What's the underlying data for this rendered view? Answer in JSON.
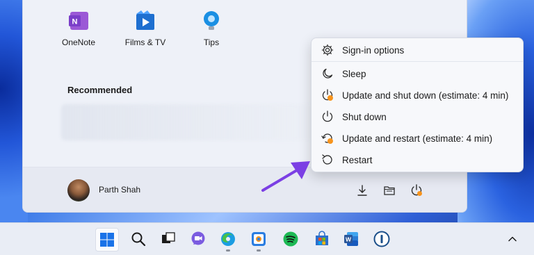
{
  "start_menu": {
    "pinned": [
      {
        "label": "OneNote",
        "icon": "onenote-icon"
      },
      {
        "label": "Films & TV",
        "icon": "films-tv-icon"
      },
      {
        "label": "Tips",
        "icon": "tips-icon"
      }
    ],
    "recommended_title": "Recommended",
    "user": {
      "name": "Parth Shah"
    },
    "footer_icons": [
      "downloads-icon",
      "file-explorer-icon",
      "power-icon"
    ]
  },
  "power_menu": {
    "items": [
      {
        "label": "Sign-in options",
        "icon": "gear-icon"
      },
      {
        "label": "Sleep",
        "icon": "moon-icon"
      },
      {
        "label": "Update and shut down (estimate: 4 min)",
        "icon": "power-update-icon"
      },
      {
        "label": "Shut down",
        "icon": "power-icon"
      },
      {
        "label": "Update and restart (estimate: 4 min)",
        "icon": "restart-update-icon"
      },
      {
        "label": "Restart",
        "icon": "restart-icon"
      }
    ]
  },
  "taskbar": {
    "apps": [
      "start-icon",
      "search-icon",
      "task-view-icon",
      "chat-icon",
      "edge-icon",
      "app-icon",
      "spotify-icon",
      "store-icon",
      "word-icon",
      "1password-icon"
    ],
    "overflow_icon": "chevron-up-icon"
  },
  "colors": {
    "accent": "#7b3fe4",
    "update_badge": "#f7941d",
    "onenote": "#7b3fc9",
    "spotify": "#1db954",
    "word": "#2b579a"
  }
}
